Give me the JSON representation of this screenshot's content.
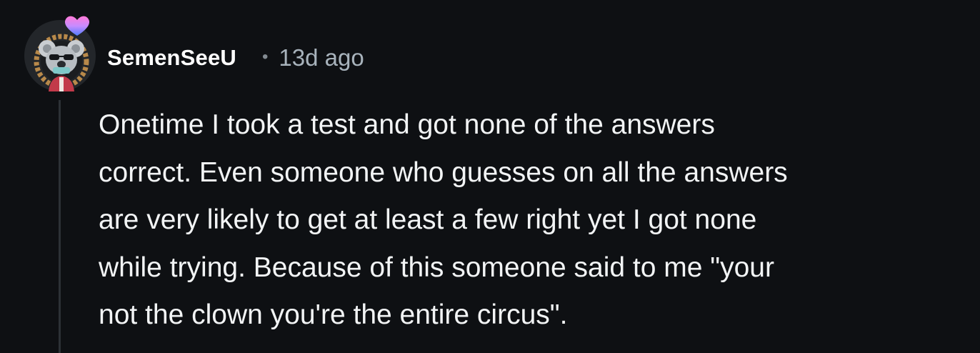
{
  "comment": {
    "author": "SemenSeeU",
    "separator": "•",
    "timestamp": "13d ago",
    "text": "Onetime I took a test and got none of the answers\ncorrect. Even someone who guesses on all the answers\nare very likely to get at least a few right yet I got none\nwhile trying. Because of this someone said to me \"your\nnot the clown you're the entire circus\".",
    "avatar_icon": "koala-avatar-icon",
    "avatar_badge_icon": "heart-badge-icon"
  },
  "colors": {
    "background": "#0e1013",
    "thread_line": "#2c3136",
    "username": "#ffffff",
    "timestamp": "#a8b3bc",
    "body_text": "#f2f4f5"
  }
}
